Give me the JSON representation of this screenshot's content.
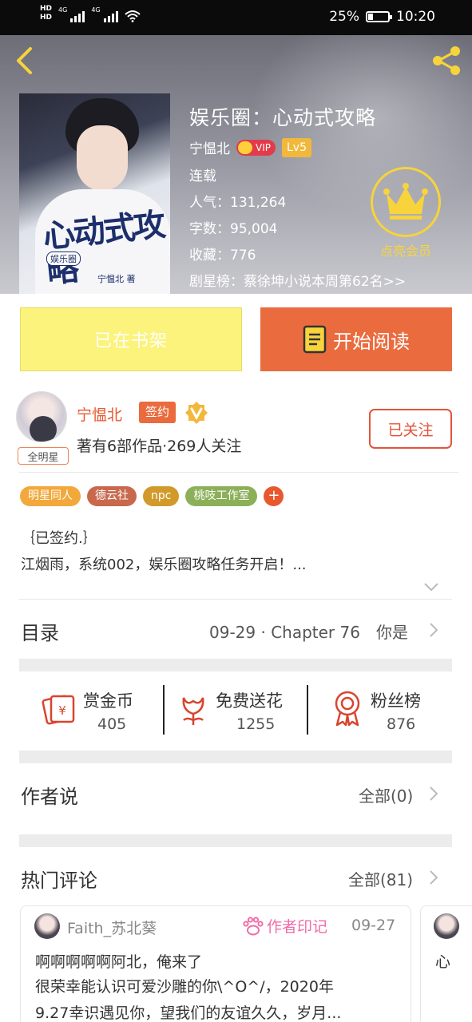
{
  "status_bar": {
    "net1": "4G",
    "net2": "4G",
    "battery": "25%",
    "battery_level": 0.25,
    "time": "10:20"
  },
  "book": {
    "title": "娱乐圈：心动式攻略",
    "author": "宁愠北",
    "vip": "VIP",
    "level": "Lv5",
    "status": "连载",
    "popularity": "人气：131,264",
    "words": "字数：95,004",
    "favorites": "收藏：776",
    "ranking": "剧星榜：蔡徐坤小说本周第62名>>"
  },
  "cover": {
    "art_title": "心动式攻略",
    "art_tag": "娱乐圈",
    "art_author": "宁愠北 著"
  },
  "member": {
    "label": "点亮会员"
  },
  "actions": {
    "shelf": "已在书架",
    "read": "开始阅读"
  },
  "author_card": {
    "name": "宁愠北",
    "sign": "签约",
    "star_badge": "全明星",
    "meta": "著有6部作品·269人关注",
    "follow": "已关注"
  },
  "tags": [
    {
      "label": "明星同人",
      "color": "#f2a83b"
    },
    {
      "label": "德云社",
      "color": "#c8694d"
    },
    {
      "label": "npc",
      "color": "#d19a2b"
    },
    {
      "label": "桃吱工作室",
      "color": "#8cb05a"
    }
  ],
  "intro": {
    "line1": "｛已签约.｝",
    "line2": "江烟雨，系统002，娱乐圈攻略任务开启！..."
  },
  "toc": {
    "label": "目录",
    "latest": "09-29 · Chapter 76　你是"
  },
  "stats": [
    {
      "label": "赏金币",
      "value": "405"
    },
    {
      "label": "免费送花",
      "value": "1255"
    },
    {
      "label": "粉丝榜",
      "value": "876"
    }
  ],
  "author_says": {
    "label": "作者说",
    "all": "全部(0)"
  },
  "hot_comments": {
    "label": "热门评论",
    "all": "全部(81)",
    "items": [
      {
        "user": "Faith_苏北葵",
        "mark": "作者印记",
        "date": "09-27",
        "line1": "啊啊啊啊啊阿北，俺来了",
        "line2": " 很荣幸能认识可爱沙雕的你\\^O^/，2020年",
        "line3": "9.27幸识遇见你，望我们的友谊久久，岁月..."
      }
    ],
    "next_preview": "心"
  },
  "colors": {
    "accent": "#ea6b3e",
    "shelf": "#fbf37c",
    "gold": "#f7d33c",
    "pink": "#f06ca8"
  }
}
